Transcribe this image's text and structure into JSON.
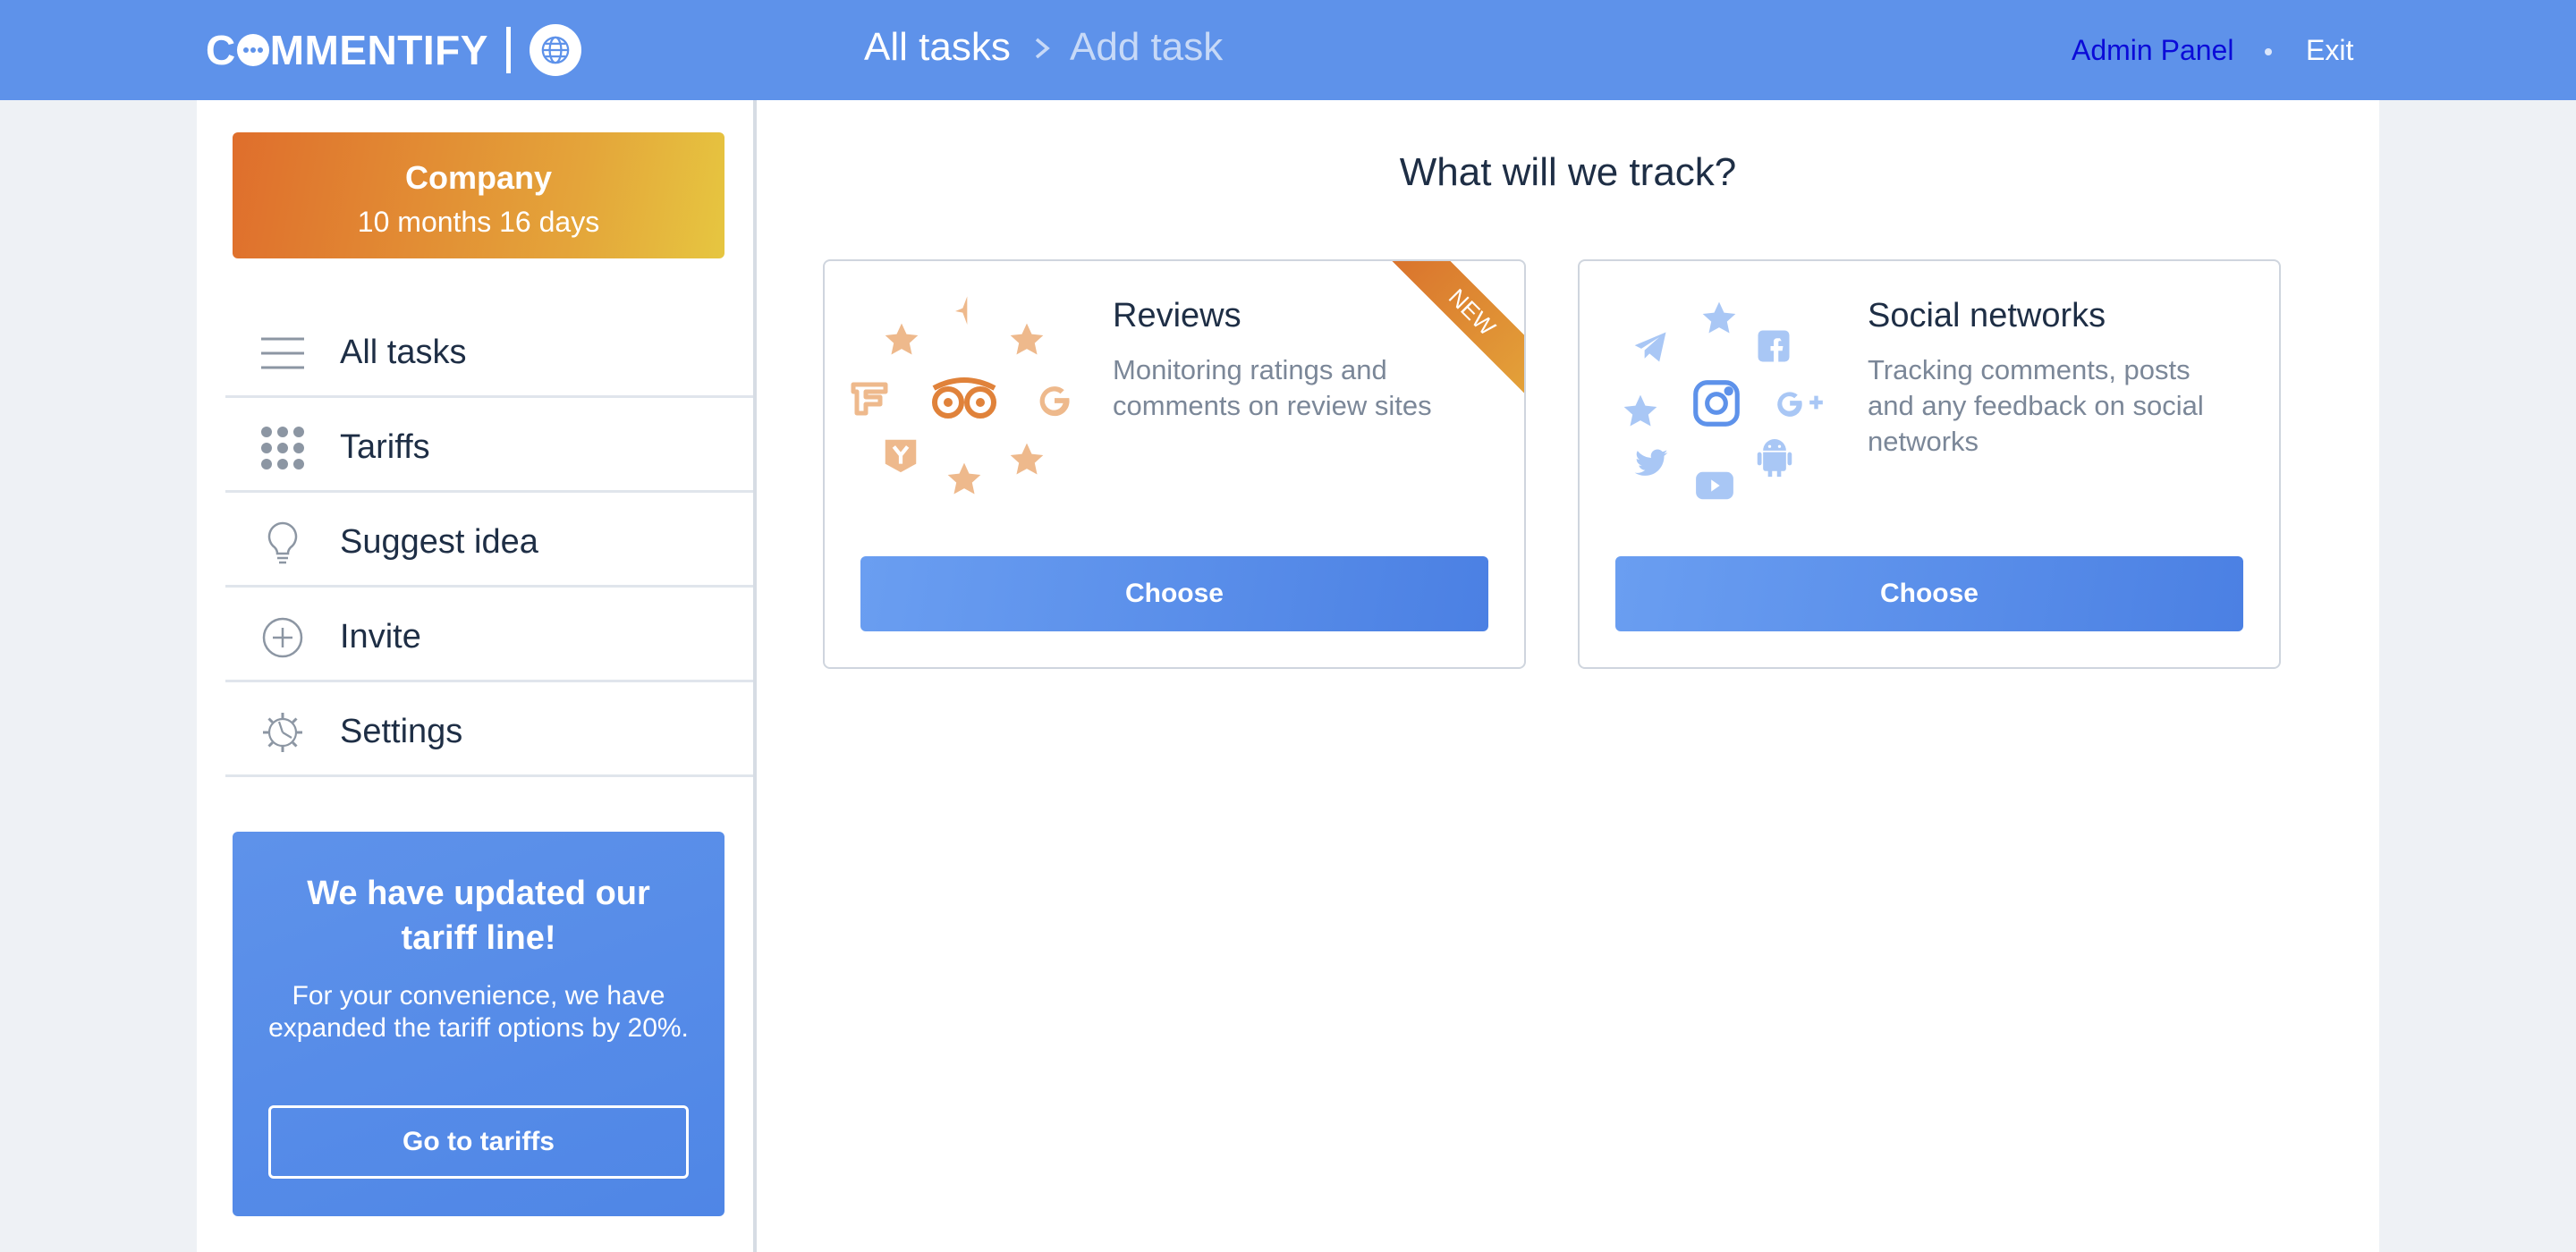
{
  "header": {
    "logo_prefix": "C",
    "logo_suffix": "MMENTIFY",
    "breadcrumb": [
      "All tasks",
      "Add task"
    ],
    "admin_link": "Admin Panel",
    "exit_link": "Exit"
  },
  "sidebar": {
    "company": {
      "name": "Company",
      "subscription": "10 months 16 days"
    },
    "items": [
      {
        "label": "All tasks",
        "icon": "menu-icon"
      },
      {
        "label": "Tariffs",
        "icon": "grid-icon"
      },
      {
        "label": "Suggest idea",
        "icon": "lightbulb-icon"
      },
      {
        "label": "Invite",
        "icon": "plus-circle-icon"
      },
      {
        "label": "Settings",
        "icon": "gear-icon"
      }
    ],
    "promo": {
      "title": "We have updated our tariff line!",
      "text": "For your convenience, we have expanded the tariff options by 20%.",
      "button": "Go to tariffs"
    }
  },
  "main": {
    "title": "What will we track?",
    "cards": [
      {
        "title": "Reviews",
        "description": "Monitoring ratings and comments on review sites",
        "button": "Choose",
        "ribbon": "NEW"
      },
      {
        "title": "Social networks",
        "description": "Tracking comments, posts and any feedback on social networks",
        "button": "Choose"
      }
    ]
  },
  "colors": {
    "header_bg": "#5e92ea",
    "accent_orange": "#df6e2c",
    "review_icon": "#eeb98c",
    "social_icon": "#a9c7f5",
    "text_dark": "#1e2e45",
    "text_muted": "#7b8798"
  }
}
